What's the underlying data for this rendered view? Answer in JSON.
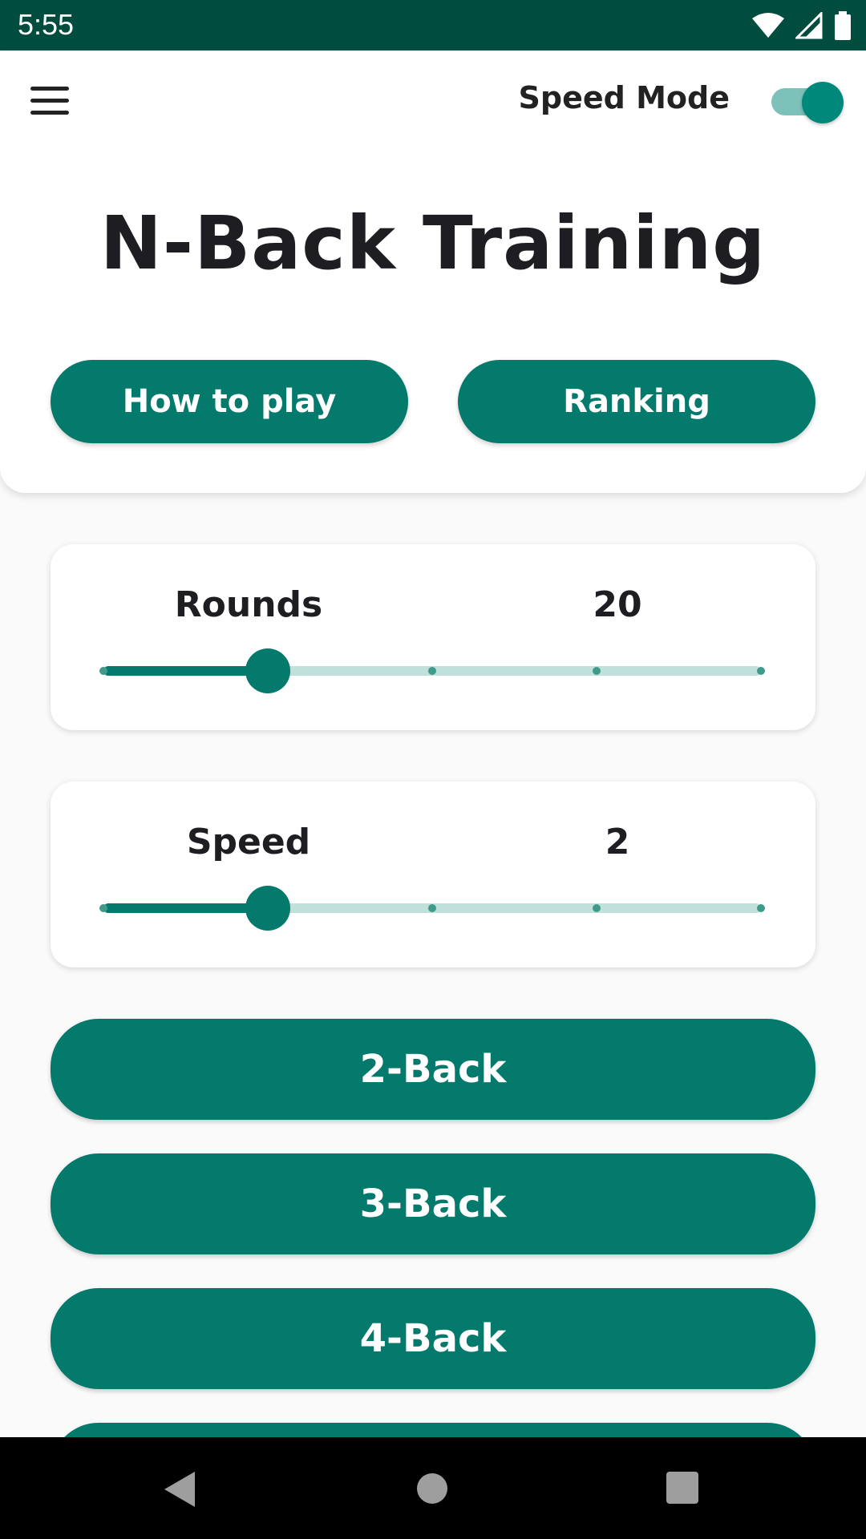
{
  "status_bar": {
    "time": "5:55"
  },
  "header": {
    "speed_mode_label": "Speed Mode",
    "speed_mode_on": true,
    "title": "N-Back Training",
    "how_to_play_label": "How to play",
    "ranking_label": "Ranking"
  },
  "sliders": {
    "rounds": {
      "label": "Rounds",
      "value": "20",
      "position": 0.25,
      "steps": 5
    },
    "speed": {
      "label": "Speed",
      "value": "2",
      "position": 0.25,
      "steps": 5
    }
  },
  "modes": [
    {
      "label": "2-Back"
    },
    {
      "label": "3-Back"
    },
    {
      "label": "4-Back"
    }
  ],
  "colors": {
    "primary": "#047a6c",
    "status_bar": "#004d40",
    "track": "#c0e0da"
  }
}
